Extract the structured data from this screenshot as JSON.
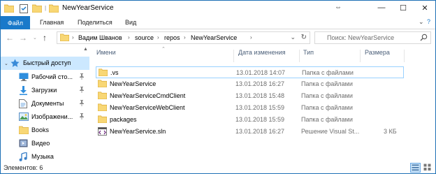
{
  "window": {
    "title": "NewYearService"
  },
  "titlebar": {
    "qa_separator": "|",
    "minimize": "—",
    "maximize": "☐",
    "close": "✕"
  },
  "ribbon": {
    "tabs": [
      {
        "label": "Файл"
      },
      {
        "label": "Главная"
      },
      {
        "label": "Поделиться"
      },
      {
        "label": "Вид"
      }
    ],
    "expand": "⌄",
    "help": "?"
  },
  "address": {
    "crumbs": [
      "Вадим Шванов",
      "source",
      "repos",
      "NewYearService"
    ],
    "separator": "›",
    "search_placeholder": "Поиск: NewYearService"
  },
  "nav": {
    "items": [
      {
        "label": "Быстрый доступ",
        "icon": "star-icon",
        "selected": true,
        "pinned": false
      },
      {
        "label": "Рабочий сто...",
        "icon": "desktop-icon",
        "selected": false,
        "pinned": true
      },
      {
        "label": "Загрузки",
        "icon": "download-icon",
        "selected": false,
        "pinned": true
      },
      {
        "label": "Документы",
        "icon": "documents-icon",
        "selected": false,
        "pinned": true
      },
      {
        "label": "Изображени...",
        "icon": "pictures-icon",
        "selected": false,
        "pinned": true
      },
      {
        "label": "Books",
        "icon": "folder-icon",
        "selected": false,
        "pinned": false
      },
      {
        "label": "Видео",
        "icon": "video-icon",
        "selected": false,
        "pinned": false
      },
      {
        "label": "Музыка",
        "icon": "music-icon",
        "selected": false,
        "pinned": false
      }
    ],
    "pin_glyph": "📌"
  },
  "columns": {
    "name": "Имени",
    "date": "Дата изменения",
    "type": "Тип",
    "size": "Размера"
  },
  "files": [
    {
      "name": ".vs",
      "date": "13.01.2018 14:07",
      "type": "Папка с файлами",
      "size": "",
      "icon": "folder-icon",
      "focused": true
    },
    {
      "name": "NewYearService",
      "date": "13.01.2018 16:27",
      "type": "Папка с файлами",
      "size": "",
      "icon": "folder-icon",
      "focused": false
    },
    {
      "name": "NewYearServiceCmdClient",
      "date": "13.01.2018 15:48",
      "type": "Папка с файлами",
      "size": "",
      "icon": "folder-icon",
      "focused": false
    },
    {
      "name": "NewYearServiceWebClient",
      "date": "13.01.2018 15:59",
      "type": "Папка с файлами",
      "size": "",
      "icon": "folder-icon",
      "focused": false
    },
    {
      "name": "packages",
      "date": "13.01.2018 15:59",
      "type": "Папка с файлами",
      "size": "",
      "icon": "folder-icon",
      "focused": false
    },
    {
      "name": "NewYearService.sln",
      "date": "13.01.2018 16:27",
      "type": "Решение Visual St...",
      "size": "3 КБ",
      "icon": "solution-file-icon",
      "focused": false
    }
  ],
  "status": {
    "text": "Элементов: 6"
  },
  "colors": {
    "accent": "#1979ca",
    "folder": "#f8d775",
    "selection": "#cce8ff"
  }
}
